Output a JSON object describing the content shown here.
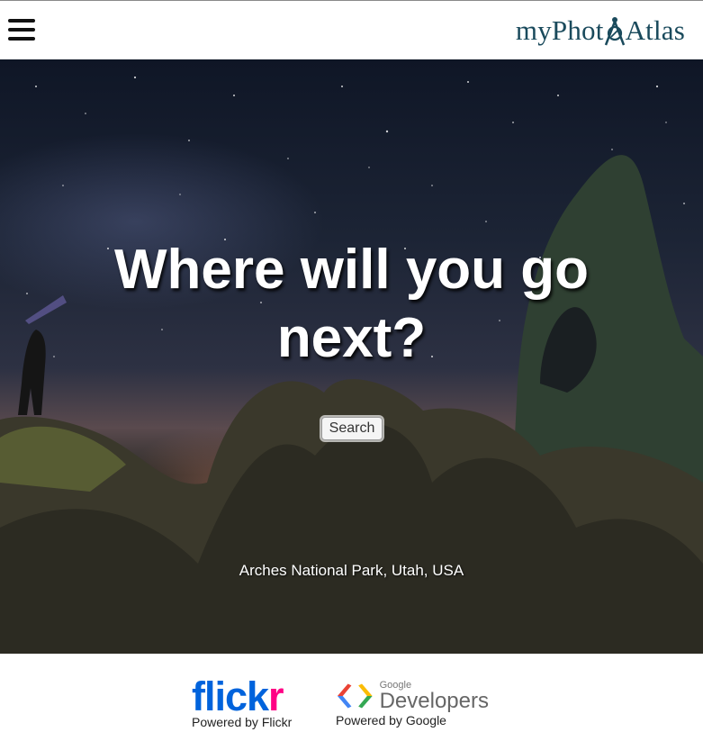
{
  "header": {
    "menu_icon": "hamburger-menu-icon",
    "logo": {
      "prefix": "myPhot",
      "suffix": "Atlas",
      "color": "#1a4a5c"
    }
  },
  "hero": {
    "headline_line1": "Where will you go",
    "headline_line2": "next?",
    "search_label": "Search",
    "location": "Arches National Park, Utah, USA"
  },
  "footer": {
    "flickr": {
      "logo_part1": "flick",
      "logo_part2": "r",
      "caption": "Powered by Flickr"
    },
    "google": {
      "small": "Google",
      "title": "Developers",
      "caption": "Powered by Google"
    }
  }
}
